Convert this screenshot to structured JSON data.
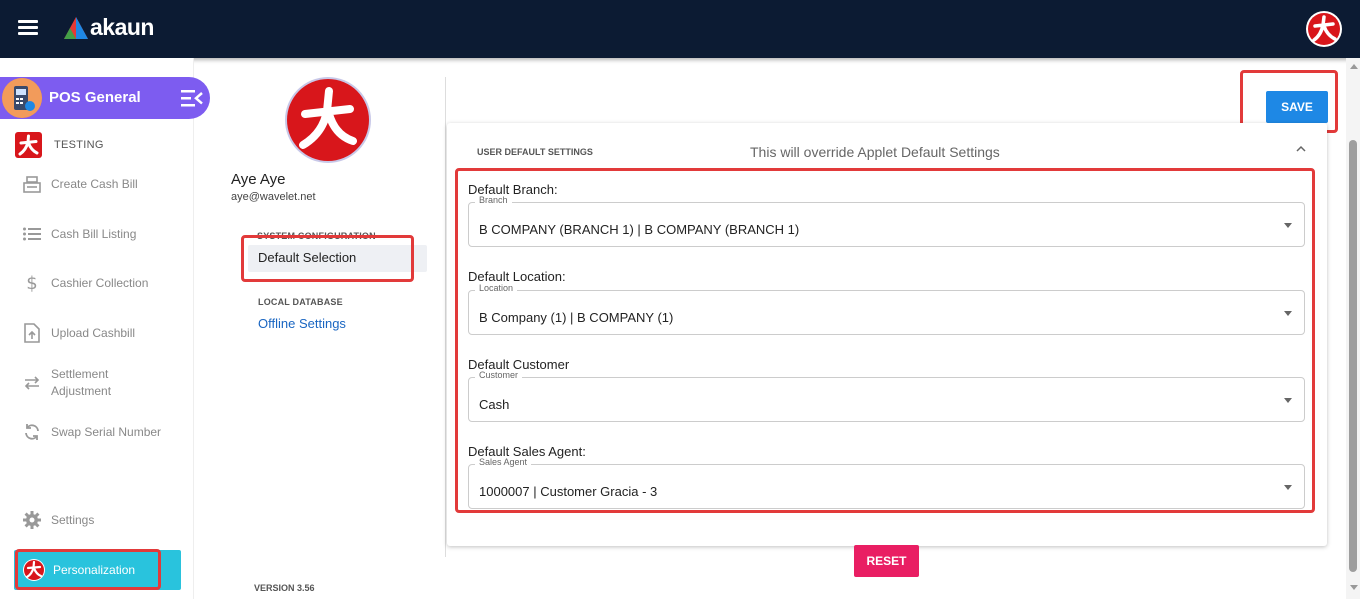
{
  "header": {
    "brand": "akaun"
  },
  "sidebar": {
    "applet_title": "POS General",
    "tenant_label": "TESTING",
    "items": [
      {
        "label": "Create Cash Bill",
        "icon": "cash-register-icon"
      },
      {
        "label": "Cash Bill Listing",
        "icon": "list-icon"
      },
      {
        "label": "Cashier Collection",
        "icon": "dollar-icon"
      },
      {
        "label": "Upload Cashbill",
        "icon": "upload-file-icon"
      },
      {
        "label": "Settlement Adjustment",
        "icon": "swap-arrows-icon"
      },
      {
        "label": "Swap Serial Number",
        "icon": "sync-icon"
      }
    ],
    "settings_label": "Settings",
    "personalization_label": "Personalization"
  },
  "profile": {
    "name": "Aye Aye",
    "email": "aye@wavelet.net",
    "system_config_label": "SYSTEM CONFIGURATION",
    "default_selection_label": "Default Selection",
    "local_database_label": "LOCAL DATABASE",
    "offline_settings_label": "Offline Settings",
    "version": "VERSION 3.56"
  },
  "content": {
    "save_label": "SAVE",
    "reset_label": "RESET",
    "card_title": "USER DEFAULT SETTINGS",
    "card_subtitle": "This will override Applet Default Settings",
    "fields": [
      {
        "label": "Default Branch:",
        "legend": "Branch",
        "value": "B COMPANY (BRANCH 1) | B COMPANY (BRANCH 1)"
      },
      {
        "label": "Default Location:",
        "legend": "Location",
        "value": "B Company (1) | B COMPANY (1)"
      },
      {
        "label": "Default Customer",
        "legend": "Customer",
        "value": "Cash"
      },
      {
        "label": "Default Sales Agent:",
        "legend": "Sales Agent",
        "value": "1000007 | Customer Gracia - 3"
      }
    ]
  },
  "colors": {
    "topbar": "#0c1b33",
    "applet_pill": "#7d5cf0",
    "save_button": "#1e88e5",
    "reset_button": "#e91e63",
    "personalization": "#29c3dd",
    "highlight": "#e23a3a",
    "link": "#1a66c2"
  }
}
